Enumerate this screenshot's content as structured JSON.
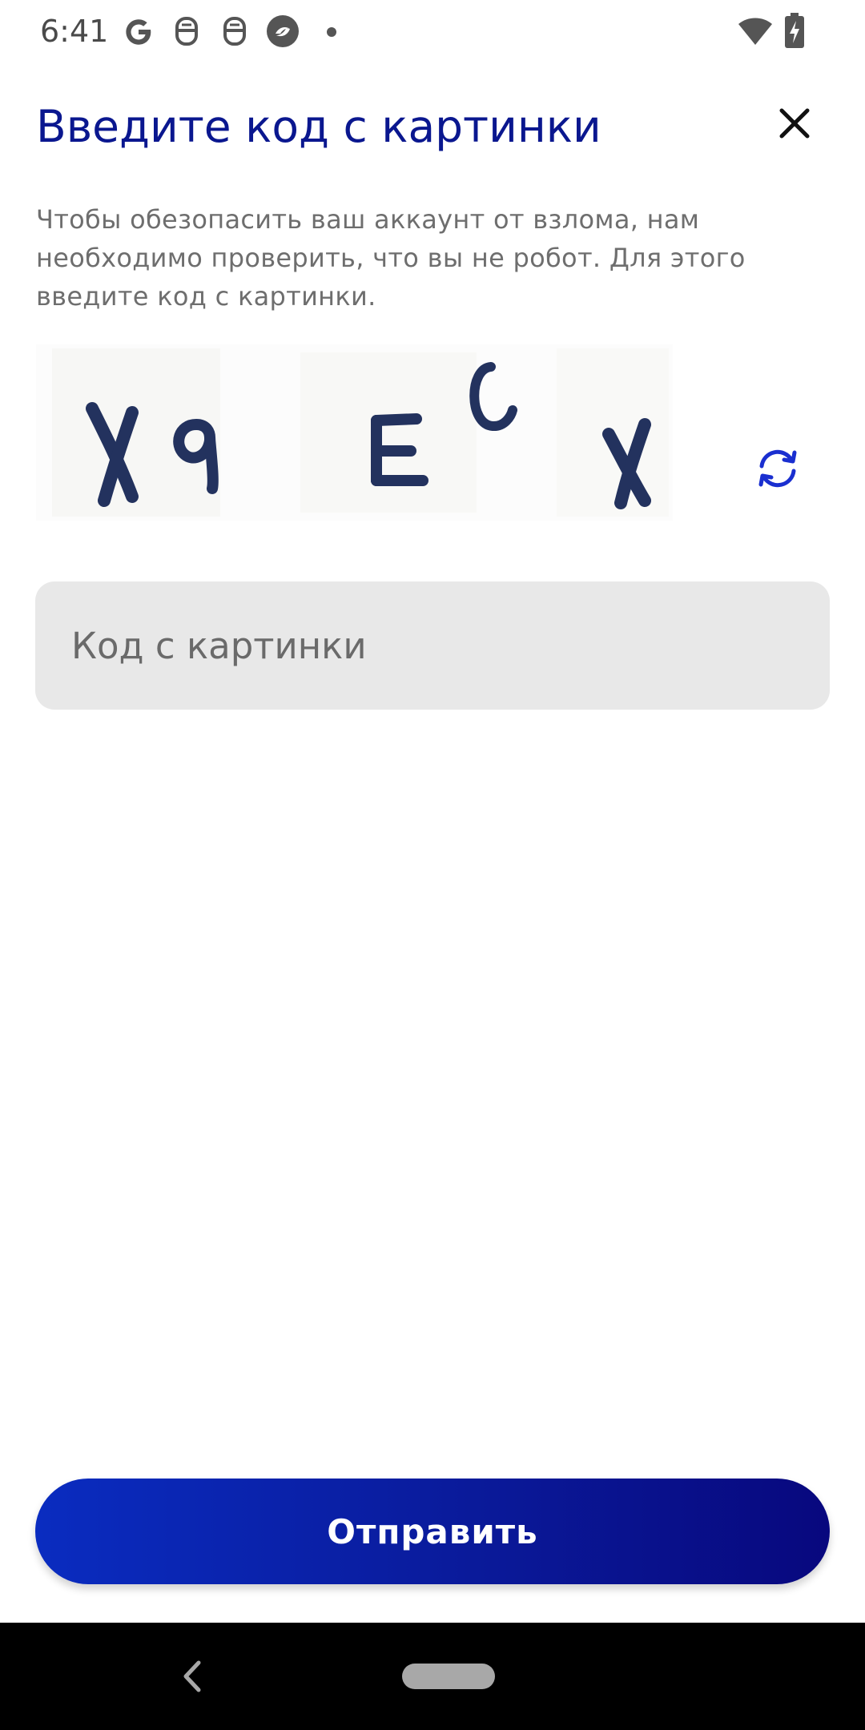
{
  "status_bar": {
    "time": "6:41",
    "icons": [
      "google-icon",
      "notification-icon",
      "notification-icon",
      "app-icon",
      "dot-icon",
      "wifi-icon",
      "battery-charging-icon"
    ]
  },
  "header": {
    "title": "Введите код с картинки",
    "close_icon": "close-icon"
  },
  "description": "Чтобы обезопасить ваш аккаунт от взлома, нам необходимо проверить, что вы не робот. Для этого введите код с картинки.",
  "captcha": {
    "text": "X9ECX",
    "refresh_icon": "refresh-icon"
  },
  "input": {
    "placeholder": "Код с картинки",
    "value": ""
  },
  "submit": {
    "label": "Отправить"
  },
  "nav": {
    "back_icon": "back-icon",
    "home_icon": "home-pill-icon"
  },
  "colors": {
    "accent": "#0a178f",
    "button_gradient_start": "#0a2cc0",
    "button_gradient_end": "#08087e",
    "input_bg": "#e8e8e8"
  }
}
